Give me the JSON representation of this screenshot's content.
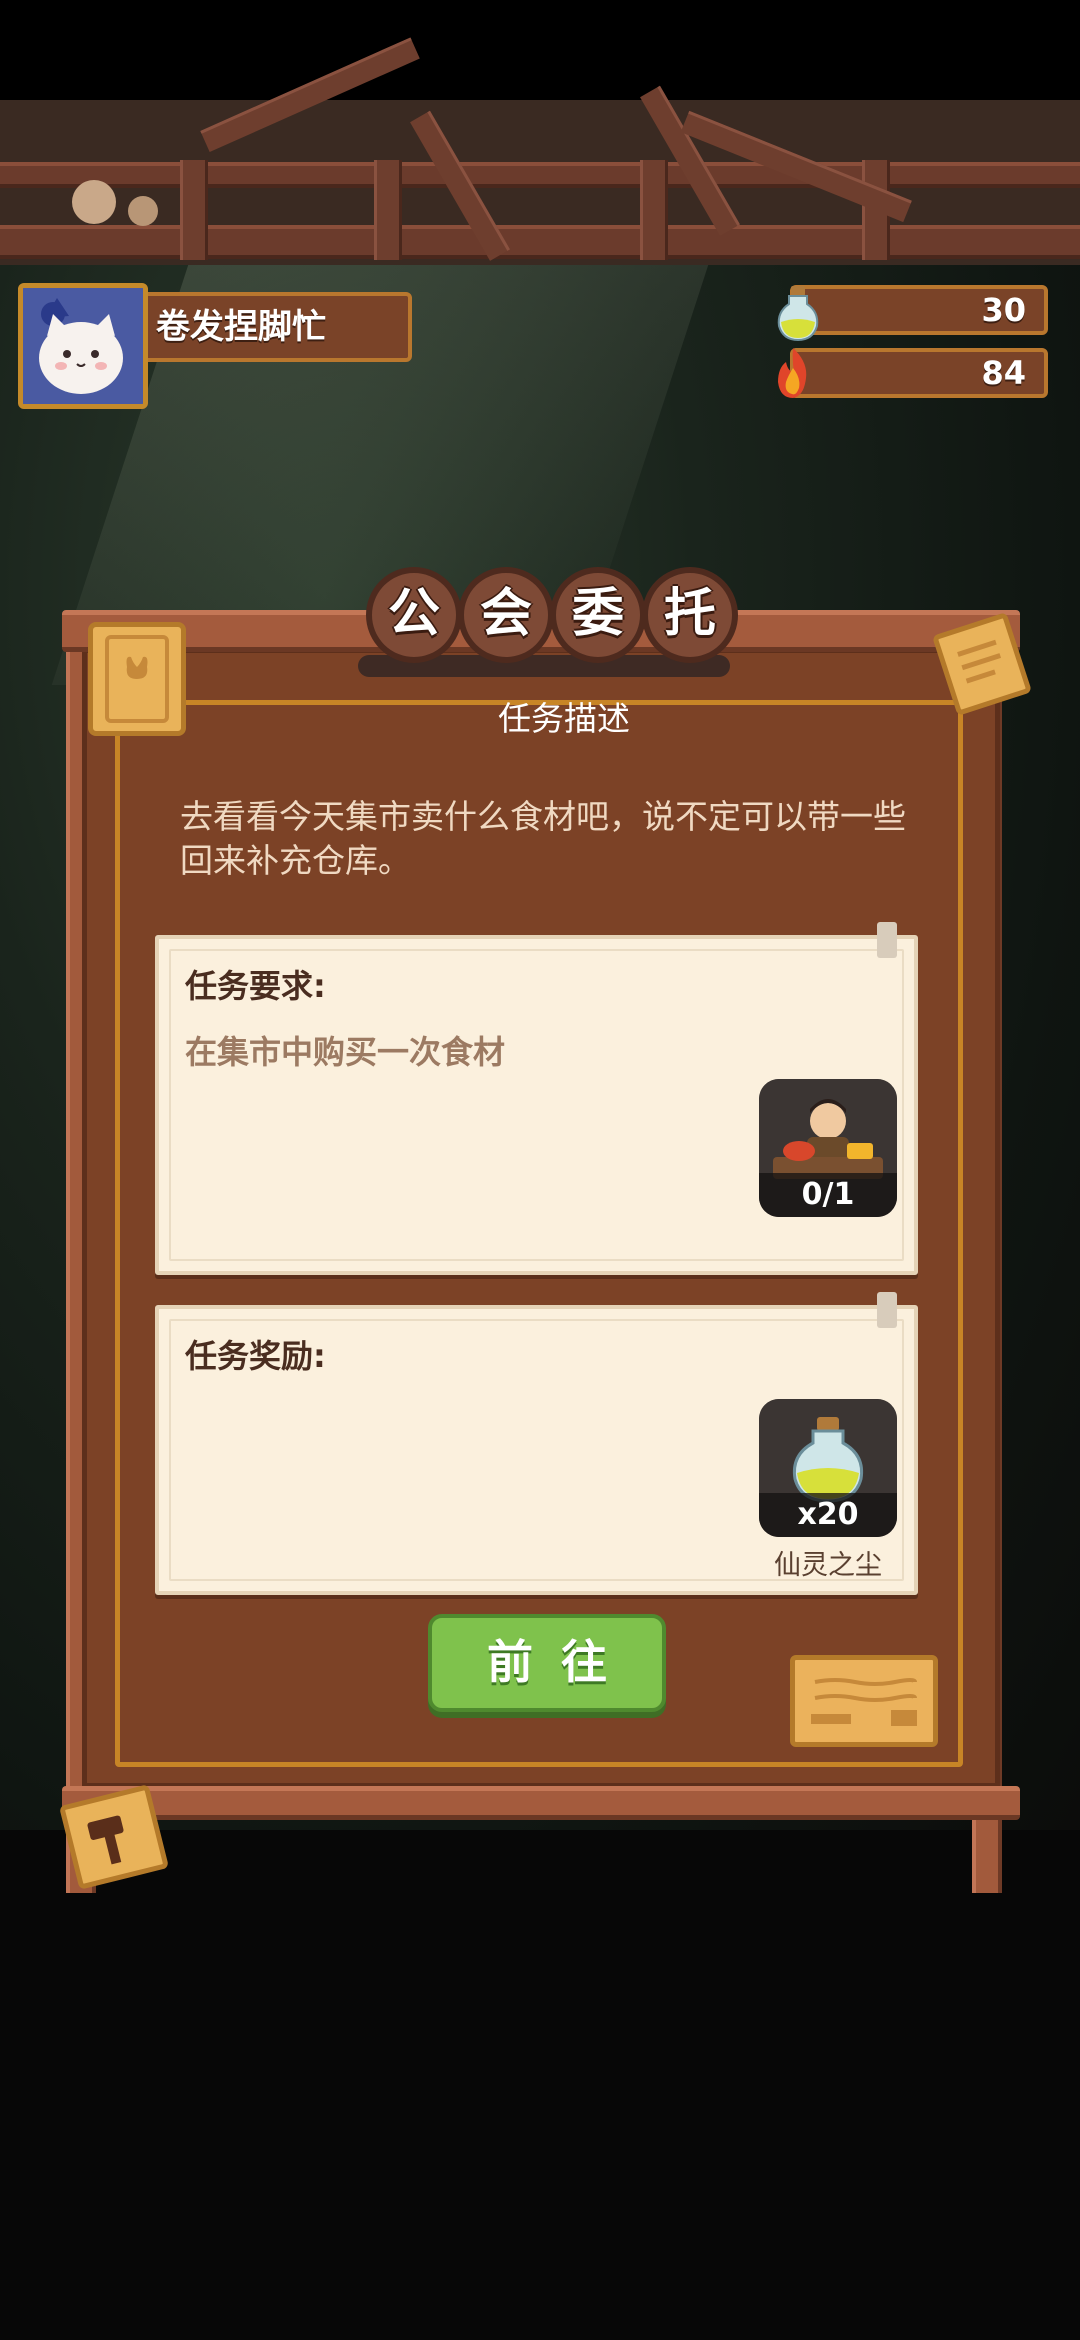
{
  "player": {
    "name": "卷发捏脚忙"
  },
  "resources": [
    {
      "icon": "potion-bottle-icon",
      "value": "30"
    },
    {
      "icon": "fire-orb-icon",
      "value": "84"
    }
  ],
  "panel": {
    "title_chars": [
      "公",
      "会",
      "委",
      "托"
    ],
    "section_label": "任务描述",
    "description": "去看看今天集市卖什么食材吧，说不定可以带一些回来补充仓库。",
    "requirement": {
      "title": "任务要求:",
      "text": "在集市中购买一次食材",
      "progress": "0/1"
    },
    "reward": {
      "title": "任务奖励:",
      "count": "x20",
      "item_name": "仙灵之尘"
    },
    "go_button": "前往"
  },
  "colors": {
    "board": "#7c4226",
    "board_frame": "#a45b3d",
    "accent_gold": "#c88526",
    "button_green": "#7fc24c",
    "note_paper": "#fbf0dd"
  }
}
